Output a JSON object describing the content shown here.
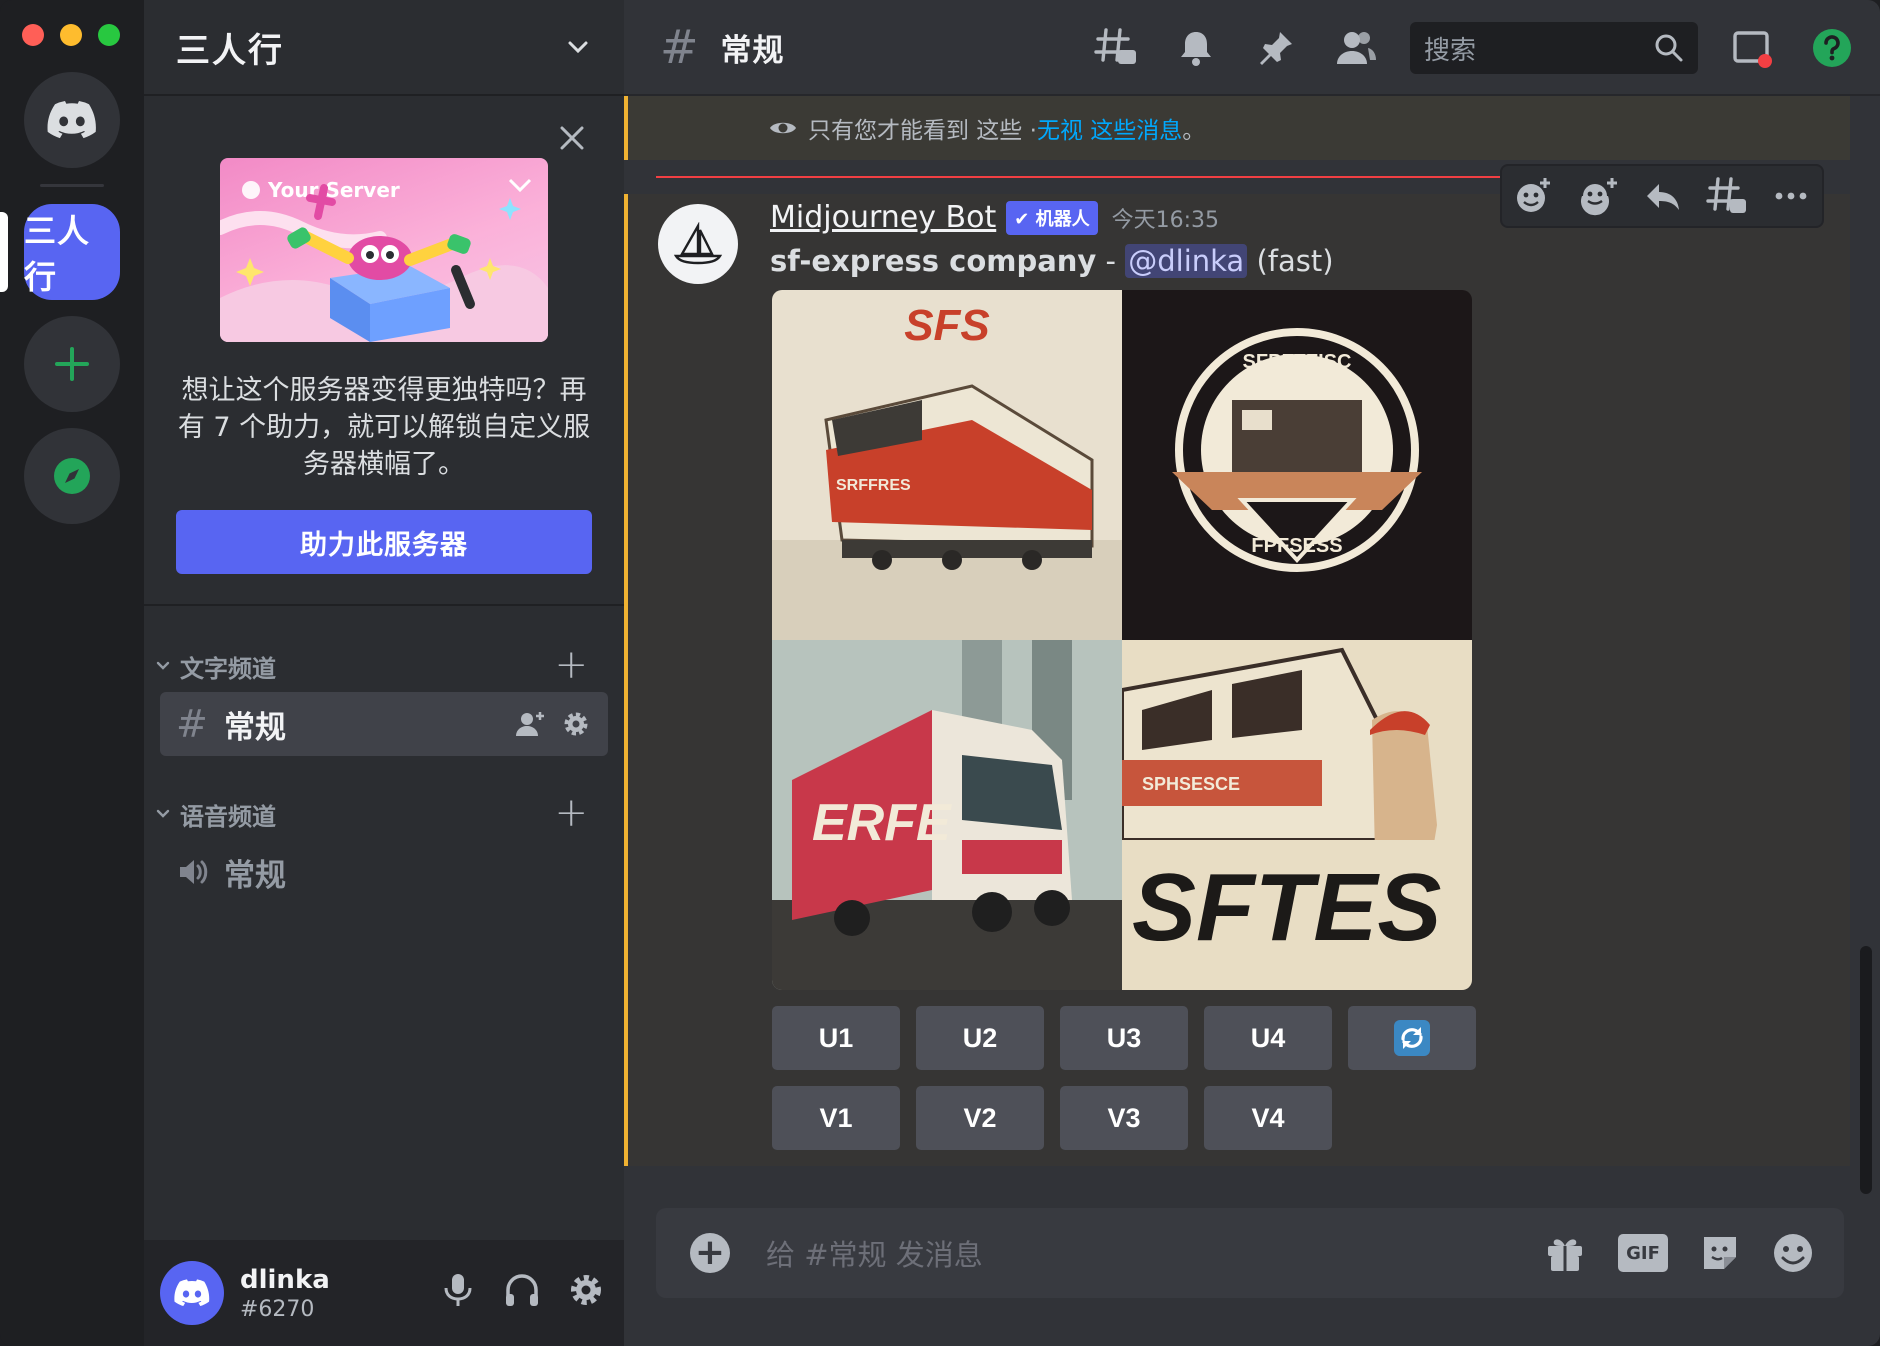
{
  "window": {
    "traffic_lights": [
      "close",
      "minimize",
      "zoom"
    ]
  },
  "rail": {
    "server_label": "三人行"
  },
  "sidebar": {
    "server_name": "三人行",
    "boost": {
      "banner_label": "Your Server",
      "text": "想让这个服务器变得更独特吗？再有 7 个助力，就可以解锁自定义服务器横幅了。",
      "button": "助力此服务器"
    },
    "categories": {
      "text": "文字频道",
      "voice": "语音频道"
    },
    "channels": {
      "text_active": "常规",
      "voice": "常规"
    },
    "user": {
      "name": "dlinka",
      "tag": "#6270"
    }
  },
  "header": {
    "channel": "常规",
    "search_placeholder": "搜索"
  },
  "ephemeral": {
    "prefix": "只有您才能看到 这些 · ",
    "link": "无视 这些消息",
    "suffix": "。"
  },
  "message": {
    "author": "Midjourney Bot",
    "bot_tag": "✔ 机器人",
    "timestamp": "今天16:35",
    "prompt": "sf-express company",
    "sep": " - ",
    "mention": "@dlinka",
    "mode": "(fast)",
    "images": [
      "SFS",
      "SFPFFFISC",
      "ERFE",
      "SFTES"
    ],
    "upscale_buttons": [
      "U1",
      "U2",
      "U3",
      "U4"
    ],
    "variation_buttons": [
      "V1",
      "V2",
      "V3",
      "V4"
    ]
  },
  "composer": {
    "placeholder": "给 #常规 发消息",
    "gif_label": "GIF"
  },
  "colors": {
    "blurple": "#5865f2",
    "green": "#23a559",
    "ephemeral_accent": "#f0b232",
    "link": "#00a8fc",
    "new_messages_line": "#f23f43"
  }
}
